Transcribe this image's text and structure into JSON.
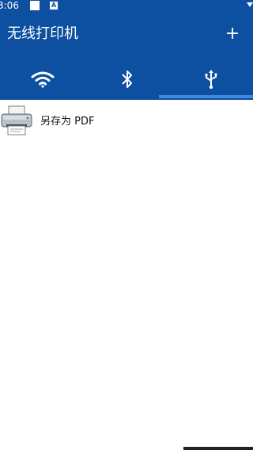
{
  "status_bar": {
    "time": "3:06",
    "badge_letter": "A"
  },
  "app_bar": {
    "title": "无线打印机",
    "add_label": "+"
  },
  "tabs": [
    {
      "id": "wifi",
      "icon": "wifi-icon",
      "selected": false
    },
    {
      "id": "bluetooth",
      "icon": "bluetooth-icon",
      "selected": false
    },
    {
      "id": "usb",
      "icon": "usb-icon",
      "selected": true
    }
  ],
  "printers": [
    {
      "label": "另存为 PDF",
      "icon": "printer-icon"
    }
  ],
  "colors": {
    "primary": "#0d4fa0",
    "tab_indicator": "#3c8ae0",
    "background": "#ffffff"
  }
}
